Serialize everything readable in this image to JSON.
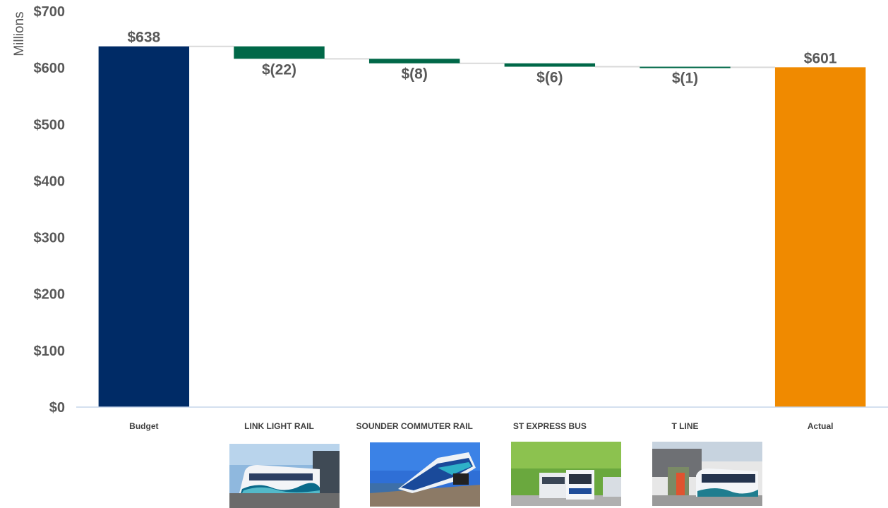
{
  "chart_data": {
    "type": "bar",
    "subtype": "waterfall",
    "unit_label": "Millions",
    "categories": [
      "Budget",
      "LINK LIGHT RAIL",
      "SOUNDER COMMUTER RAIL",
      "ST EXPRESS BUS",
      "T LINE",
      "Actual"
    ],
    "values": [
      638,
      -22,
      -8,
      -6,
      -1,
      601
    ],
    "data_labels": [
      "$638",
      "$(22)",
      "$(8)",
      "$(6)",
      "$(1)",
      "$601"
    ],
    "bar_kinds": [
      "total",
      "delta",
      "delta",
      "delta",
      "delta",
      "total"
    ],
    "ylim": [
      0,
      700
    ],
    "y_ticks": [
      0,
      100,
      200,
      300,
      400,
      500,
      600,
      700
    ],
    "y_tick_labels": [
      "$0",
      "$100",
      "$200",
      "$300",
      "$400",
      "$500",
      "$600",
      "$700"
    ],
    "colors": {
      "budget": "#002B66",
      "delta": "#006848",
      "actual": "#F08A00",
      "connector": "#D9D9D9",
      "axis": "#C5D5EA",
      "text": "#595959"
    },
    "grid": false,
    "legend": "none"
  },
  "photos": [
    {
      "category": "LINK LIGHT RAIL",
      "icon": "light-rail-train-photo"
    },
    {
      "category": "SOUNDER COMMUTER RAIL",
      "icon": "commuter-train-photo"
    },
    {
      "category": "ST EXPRESS BUS",
      "icon": "express-bus-photo"
    },
    {
      "category": "T LINE",
      "icon": "streetcar-photo"
    }
  ]
}
